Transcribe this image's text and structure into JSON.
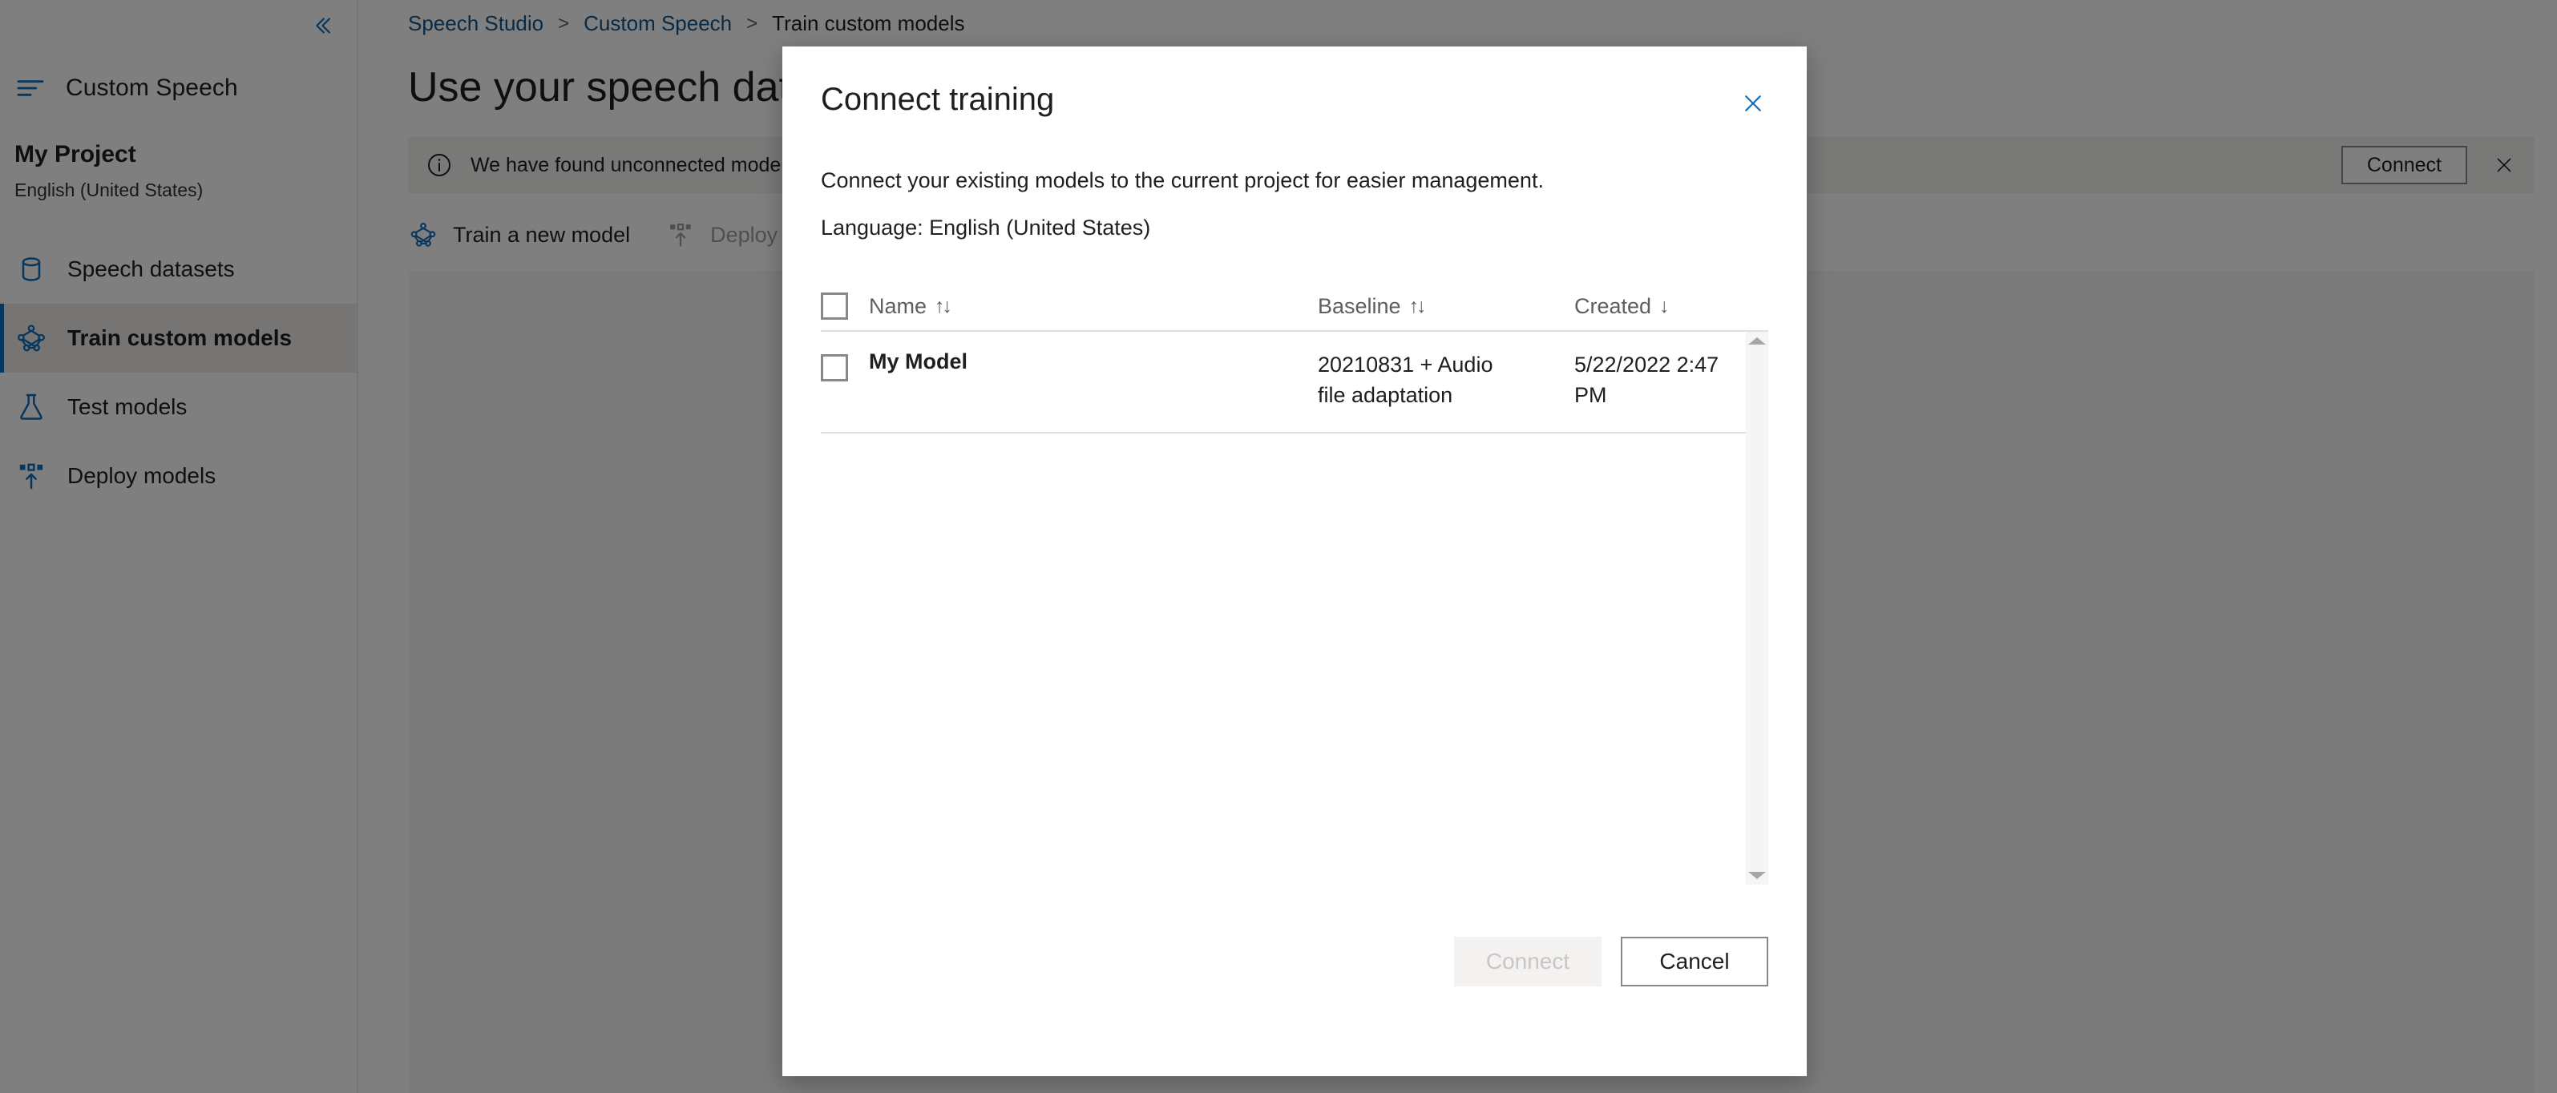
{
  "sidebar": {
    "collapse_icon": "chevron-double-left-icon",
    "brand": {
      "icon": "hamburger-icon",
      "label": "Custom Speech"
    },
    "project": {
      "name": "My Project",
      "language": "English (United States)"
    },
    "items": [
      {
        "label": "Speech datasets",
        "icon": "database-icon",
        "active": false
      },
      {
        "label": "Train custom models",
        "icon": "network-graph-icon",
        "active": true
      },
      {
        "label": "Test models",
        "icon": "flask-icon",
        "active": false
      },
      {
        "label": "Deploy models",
        "icon": "deploy-upload-icon",
        "active": false
      }
    ]
  },
  "breadcrumb": {
    "items": [
      "Speech Studio",
      "Custom Speech",
      "Train custom models"
    ],
    "separator": ">"
  },
  "page": {
    "title": "Use your speech data to train a custom model"
  },
  "banner": {
    "icon": "info-circle-icon",
    "text": "We have found unconnected models in your Speech resource. Do you want to connect these entities to this project so you can ...",
    "connect_label": "Connect",
    "close_icon": "close-icon"
  },
  "toolbar": {
    "items": [
      {
        "label": "Train a new model",
        "icon": "network-graph-icon",
        "disabled": false
      },
      {
        "label": "Deploy model",
        "icon": "deploy-upload-icon",
        "disabled": true
      }
    ]
  },
  "dialog": {
    "title": "Connect training",
    "close_icon": "close-icon",
    "description": "Connect your existing models to the current project for easier management.",
    "language_line": "Language: English (United States)",
    "table": {
      "select_all_checked": false,
      "columns": [
        {
          "label": "Name",
          "sort_icon": "↑↓"
        },
        {
          "label": "Baseline",
          "sort_icon": "↑↓"
        },
        {
          "label": "Created",
          "sort_icon": "↓"
        }
      ],
      "rows": [
        {
          "checked": false,
          "name": "My Model",
          "baseline": "20210831 + Audio file adaptation",
          "created": "5/22/2022 2:47 PM"
        }
      ]
    },
    "scrollbar": {
      "up_icon": "scroll-up-arrow-icon",
      "down_icon": "scroll-down-arrow-icon"
    },
    "footer": {
      "connect_label": "Connect",
      "connect_disabled": true,
      "cancel_label": "Cancel"
    }
  },
  "colors": {
    "accent": "#0f6cbd",
    "link": "#0f548c",
    "text": "#201f1e",
    "muted": "#605e5c",
    "banner_bg": "#f3f2f1",
    "active_nav_bg": "#edebe9",
    "overlay": "rgba(0,0,0,0.50)"
  }
}
